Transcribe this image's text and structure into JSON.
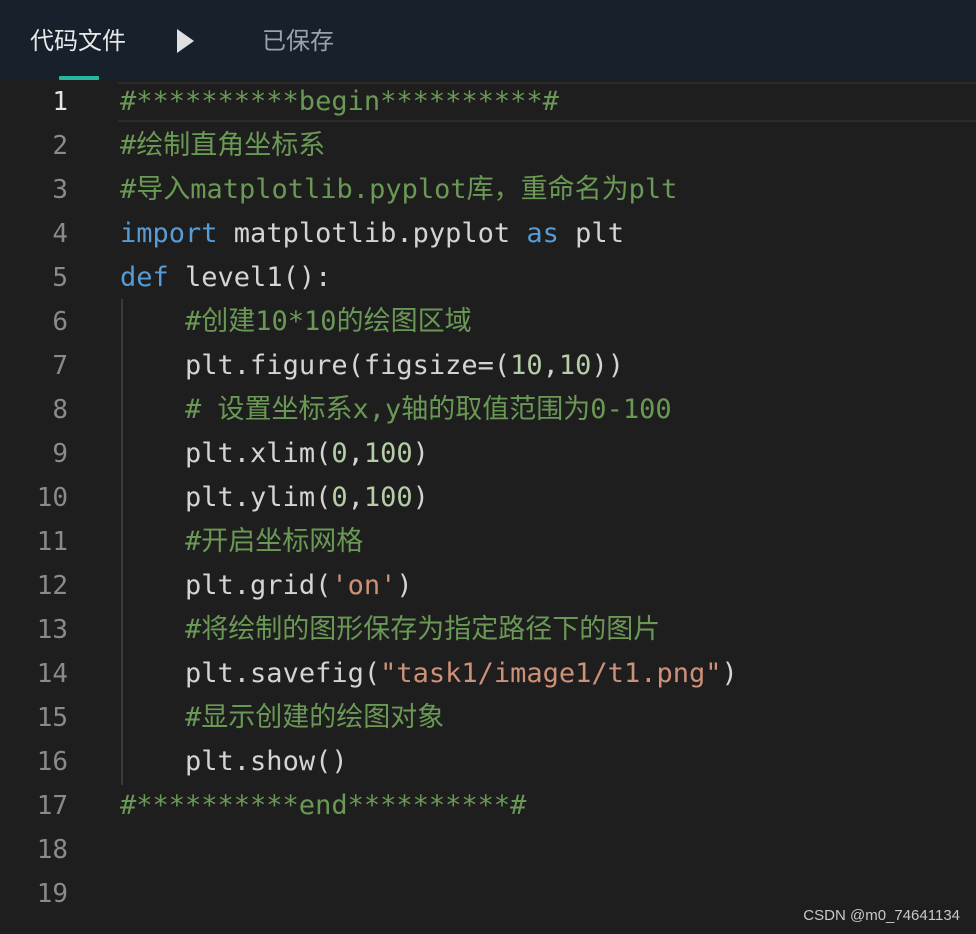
{
  "header": {
    "tab_label": "代码文件",
    "status_text": "已保存",
    "run_icon": "play-triangle-icon"
  },
  "colors": {
    "header_bg": "#17212b",
    "editor_bg": "#1e1e1e",
    "tab_accent": "#27b89f",
    "comment": "#6a9955",
    "keyword": "#569cd6",
    "string": "#ce9178",
    "number": "#b5cea8",
    "text": "#d4d4d4",
    "line_number": "#8a8a8a"
  },
  "editor": {
    "active_line": 1,
    "lines": [
      {
        "number": "1",
        "indent": "",
        "tokens": [
          {
            "t": "comment",
            "v": "#**********begin**********#"
          }
        ]
      },
      {
        "number": "2",
        "indent": "",
        "tokens": [
          {
            "t": "comment",
            "v": "#绘制直角坐标系"
          }
        ]
      },
      {
        "number": "3",
        "indent": "",
        "tokens": [
          {
            "t": "comment",
            "v": "#导入matplotlib.pyplot库，重命名为plt"
          }
        ]
      },
      {
        "number": "4",
        "indent": "",
        "tokens": [
          {
            "t": "keyword",
            "v": "import"
          },
          {
            "t": "plain",
            "v": " matplotlib.pyplot "
          },
          {
            "t": "keyword",
            "v": "as"
          },
          {
            "t": "plain",
            "v": " plt"
          }
        ]
      },
      {
        "number": "5",
        "indent": "",
        "tokens": [
          {
            "t": "keyword",
            "v": "def"
          },
          {
            "t": "plain",
            "v": " level1():"
          }
        ]
      },
      {
        "number": "6",
        "indent": "    ",
        "tokens": [
          {
            "t": "comment",
            "v": "#创建10*10的绘图区域"
          }
        ]
      },
      {
        "number": "7",
        "indent": "    ",
        "tokens": [
          {
            "t": "plain",
            "v": "plt.figure(figsize=("
          },
          {
            "t": "number",
            "v": "10"
          },
          {
            "t": "plain",
            "v": ","
          },
          {
            "t": "number",
            "v": "10"
          },
          {
            "t": "plain",
            "v": "))"
          }
        ]
      },
      {
        "number": "8",
        "indent": "    ",
        "tokens": [
          {
            "t": "comment",
            "v": "# 设置坐标系x,y轴的取值范围为0-100"
          }
        ]
      },
      {
        "number": "9",
        "indent": "    ",
        "tokens": [
          {
            "t": "plain",
            "v": "plt.xlim("
          },
          {
            "t": "number",
            "v": "0"
          },
          {
            "t": "plain",
            "v": ","
          },
          {
            "t": "number",
            "v": "100"
          },
          {
            "t": "plain",
            "v": ")"
          }
        ]
      },
      {
        "number": "10",
        "indent": "    ",
        "tokens": [
          {
            "t": "plain",
            "v": "plt.ylim("
          },
          {
            "t": "number",
            "v": "0"
          },
          {
            "t": "plain",
            "v": ","
          },
          {
            "t": "number",
            "v": "100"
          },
          {
            "t": "plain",
            "v": ")"
          }
        ]
      },
      {
        "number": "11",
        "indent": "    ",
        "tokens": [
          {
            "t": "comment",
            "v": "#开启坐标网格"
          }
        ]
      },
      {
        "number": "12",
        "indent": "    ",
        "tokens": [
          {
            "t": "plain",
            "v": "plt.grid("
          },
          {
            "t": "string",
            "v": "'on'"
          },
          {
            "t": "plain",
            "v": ")"
          }
        ]
      },
      {
        "number": "13",
        "indent": "    ",
        "tokens": [
          {
            "t": "comment",
            "v": "#将绘制的图形保存为指定路径下的图片"
          }
        ]
      },
      {
        "number": "14",
        "indent": "    ",
        "tokens": [
          {
            "t": "plain",
            "v": "plt.savefig("
          },
          {
            "t": "string",
            "v": "\"task1/image1/t1.png\""
          },
          {
            "t": "plain",
            "v": ")"
          }
        ]
      },
      {
        "number": "15",
        "indent": "    ",
        "tokens": [
          {
            "t": "comment",
            "v": "#显示创建的绘图对象"
          }
        ]
      },
      {
        "number": "16",
        "indent": "    ",
        "tokens": [
          {
            "t": "plain",
            "v": "plt.show()"
          }
        ]
      },
      {
        "number": "17",
        "indent": "",
        "tokens": [
          {
            "t": "comment",
            "v": "#**********end**********#"
          }
        ]
      },
      {
        "number": "18",
        "indent": "",
        "tokens": []
      },
      {
        "number": "19",
        "indent": "",
        "tokens": []
      }
    ]
  },
  "watermark": "CSDN @m0_74641134"
}
